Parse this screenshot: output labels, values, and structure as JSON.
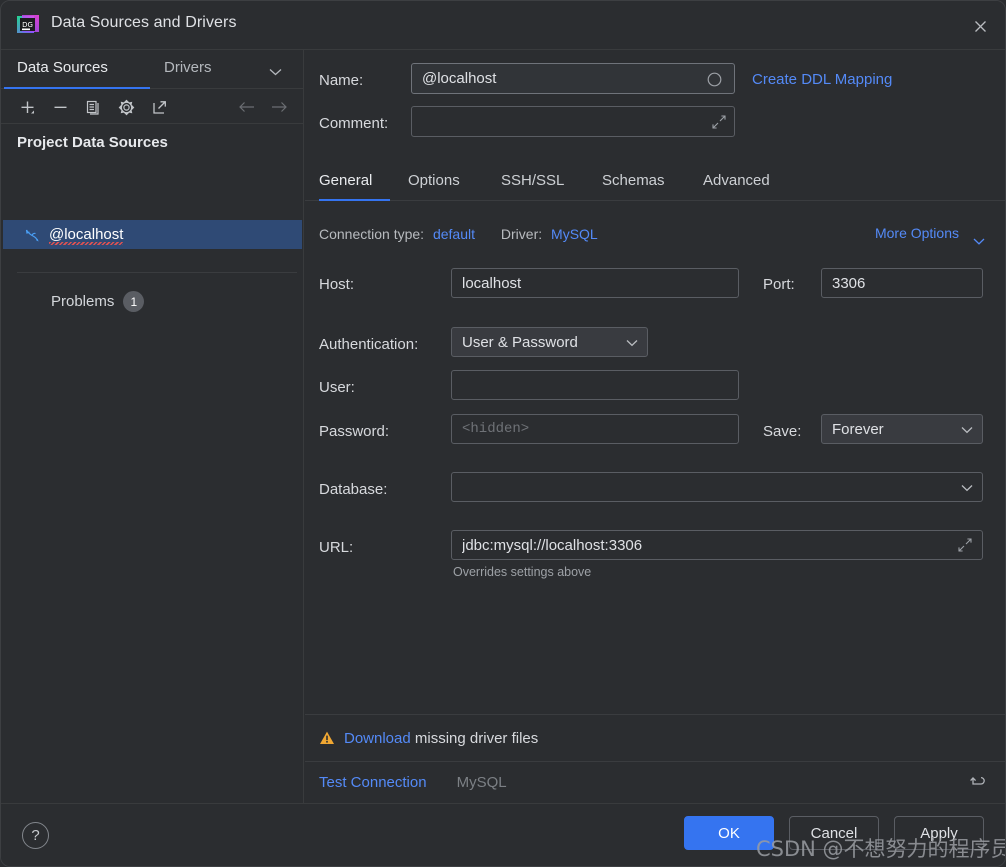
{
  "window": {
    "title": "Data Sources and Drivers",
    "logo_icon": "datagrip-logo",
    "close_icon": "close-icon"
  },
  "left_panel": {
    "tabs": [
      {
        "label": "Data Sources",
        "active": true
      },
      {
        "label": "Drivers",
        "active": false
      }
    ],
    "tabs_chevron_icon": "chevron-down-icon",
    "toolbar": [
      {
        "icon": "add-icon",
        "name": "add-data-source-button"
      },
      {
        "icon": "remove-icon",
        "name": "remove-data-source-button"
      },
      {
        "icon": "duplicate-icon",
        "name": "duplicate-data-source-button"
      },
      {
        "icon": "gear-icon",
        "name": "properties-button"
      },
      {
        "icon": "external-link-icon",
        "name": "open-in-new-window-button"
      },
      {
        "icon": "arrow-left-icon",
        "name": "navigate-back-button"
      },
      {
        "icon": "arrow-right-icon",
        "name": "navigate-forward-button"
      }
    ],
    "section_title": "Project Data Sources",
    "data_source": {
      "label": "@localhost",
      "icon": "mysql-dolphin-icon",
      "selected": true
    },
    "problems": {
      "label": "Problems",
      "count": "1"
    }
  },
  "form": {
    "name_label": "Name:",
    "name_value": "@localhost",
    "name_color_icon": "color-circle-icon",
    "create_ddl_mapping_link": "Create DDL Mapping",
    "comment_label": "Comment:",
    "comment_value": "",
    "comment_expand_icon": "expand-icon"
  },
  "tabs": [
    {
      "label": "General",
      "active": true
    },
    {
      "label": "Options",
      "active": false
    },
    {
      "label": "SSH/SSL",
      "active": false
    },
    {
      "label": "Schemas",
      "active": false
    },
    {
      "label": "Advanced",
      "active": false
    }
  ],
  "meta": {
    "connection_type_label": "Connection type:",
    "connection_type_value": "default",
    "driver_label": "Driver:",
    "driver_value": "MySQL",
    "more_options_label": "More Options",
    "more_options_icon": "chevron-down-icon"
  },
  "general": {
    "host_label": "Host:",
    "host_value": "localhost",
    "port_label": "Port:",
    "port_value": "3306",
    "authentication_label": "Authentication:",
    "authentication_value": "User & Password",
    "user_label": "User:",
    "user_value": "",
    "password_label": "Password:",
    "password_placeholder": "<hidden>",
    "password_value": "",
    "save_label": "Save:",
    "save_value": "Forever",
    "database_label": "Database:",
    "database_value": "",
    "url_label": "URL:",
    "url_value": "jdbc:mysql://localhost:3306",
    "url_expand_icon": "expand-icon",
    "url_hint": "Overrides settings above"
  },
  "warning": {
    "icon": "warning-triangle-icon",
    "link_text": "Download",
    "rest_text": "missing driver files"
  },
  "footer": {
    "test_connection_label": "Test Connection",
    "driver_name": "MySQL",
    "revert_icon": "revert-icon"
  },
  "buttons": {
    "help_label": "?",
    "ok_label": "OK",
    "cancel_label": "Cancel",
    "apply_label": "Apply"
  },
  "watermark": "CSDN @不想努力的程序员",
  "colors": {
    "accent_blue": "#3574f0",
    "link_blue": "#548af7",
    "selection_blue": "#2f4a75",
    "background": "#2b2d30",
    "warning_yellow": "#f0a732"
  }
}
